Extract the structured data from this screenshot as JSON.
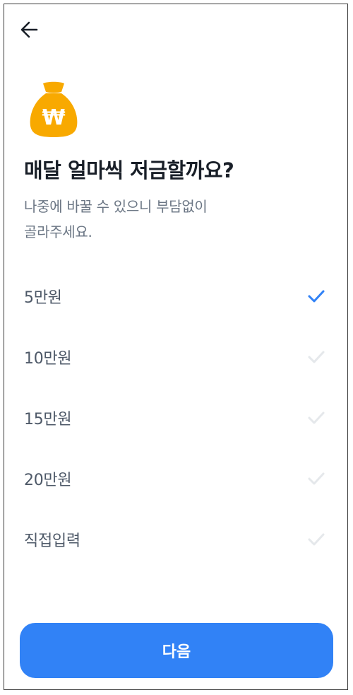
{
  "header": {
    "back_icon": "arrow-left-icon"
  },
  "hero": {
    "icon": "money-bag-won-icon",
    "icon_symbol": "₩",
    "icon_color": "#f8a900",
    "title": "매달 얼마씩 저금할까요?",
    "subtitle_line1": "나중에 바꿀 수 있으니 부담없이",
    "subtitle_line2": "골라주세요."
  },
  "options": [
    {
      "label": "5만원",
      "selected": true
    },
    {
      "label": "10만원",
      "selected": false
    },
    {
      "label": "15만원",
      "selected": false
    },
    {
      "label": "20만원",
      "selected": false
    },
    {
      "label": "직접입력",
      "selected": false
    }
  ],
  "footer": {
    "next_label": "다음"
  },
  "colors": {
    "accent": "#3182f6",
    "check_selected": "#3182f6",
    "check_unselected": "#e5e8eb",
    "title": "#191f28",
    "subtitle": "#6b7684",
    "option_text": "#4e5968"
  }
}
